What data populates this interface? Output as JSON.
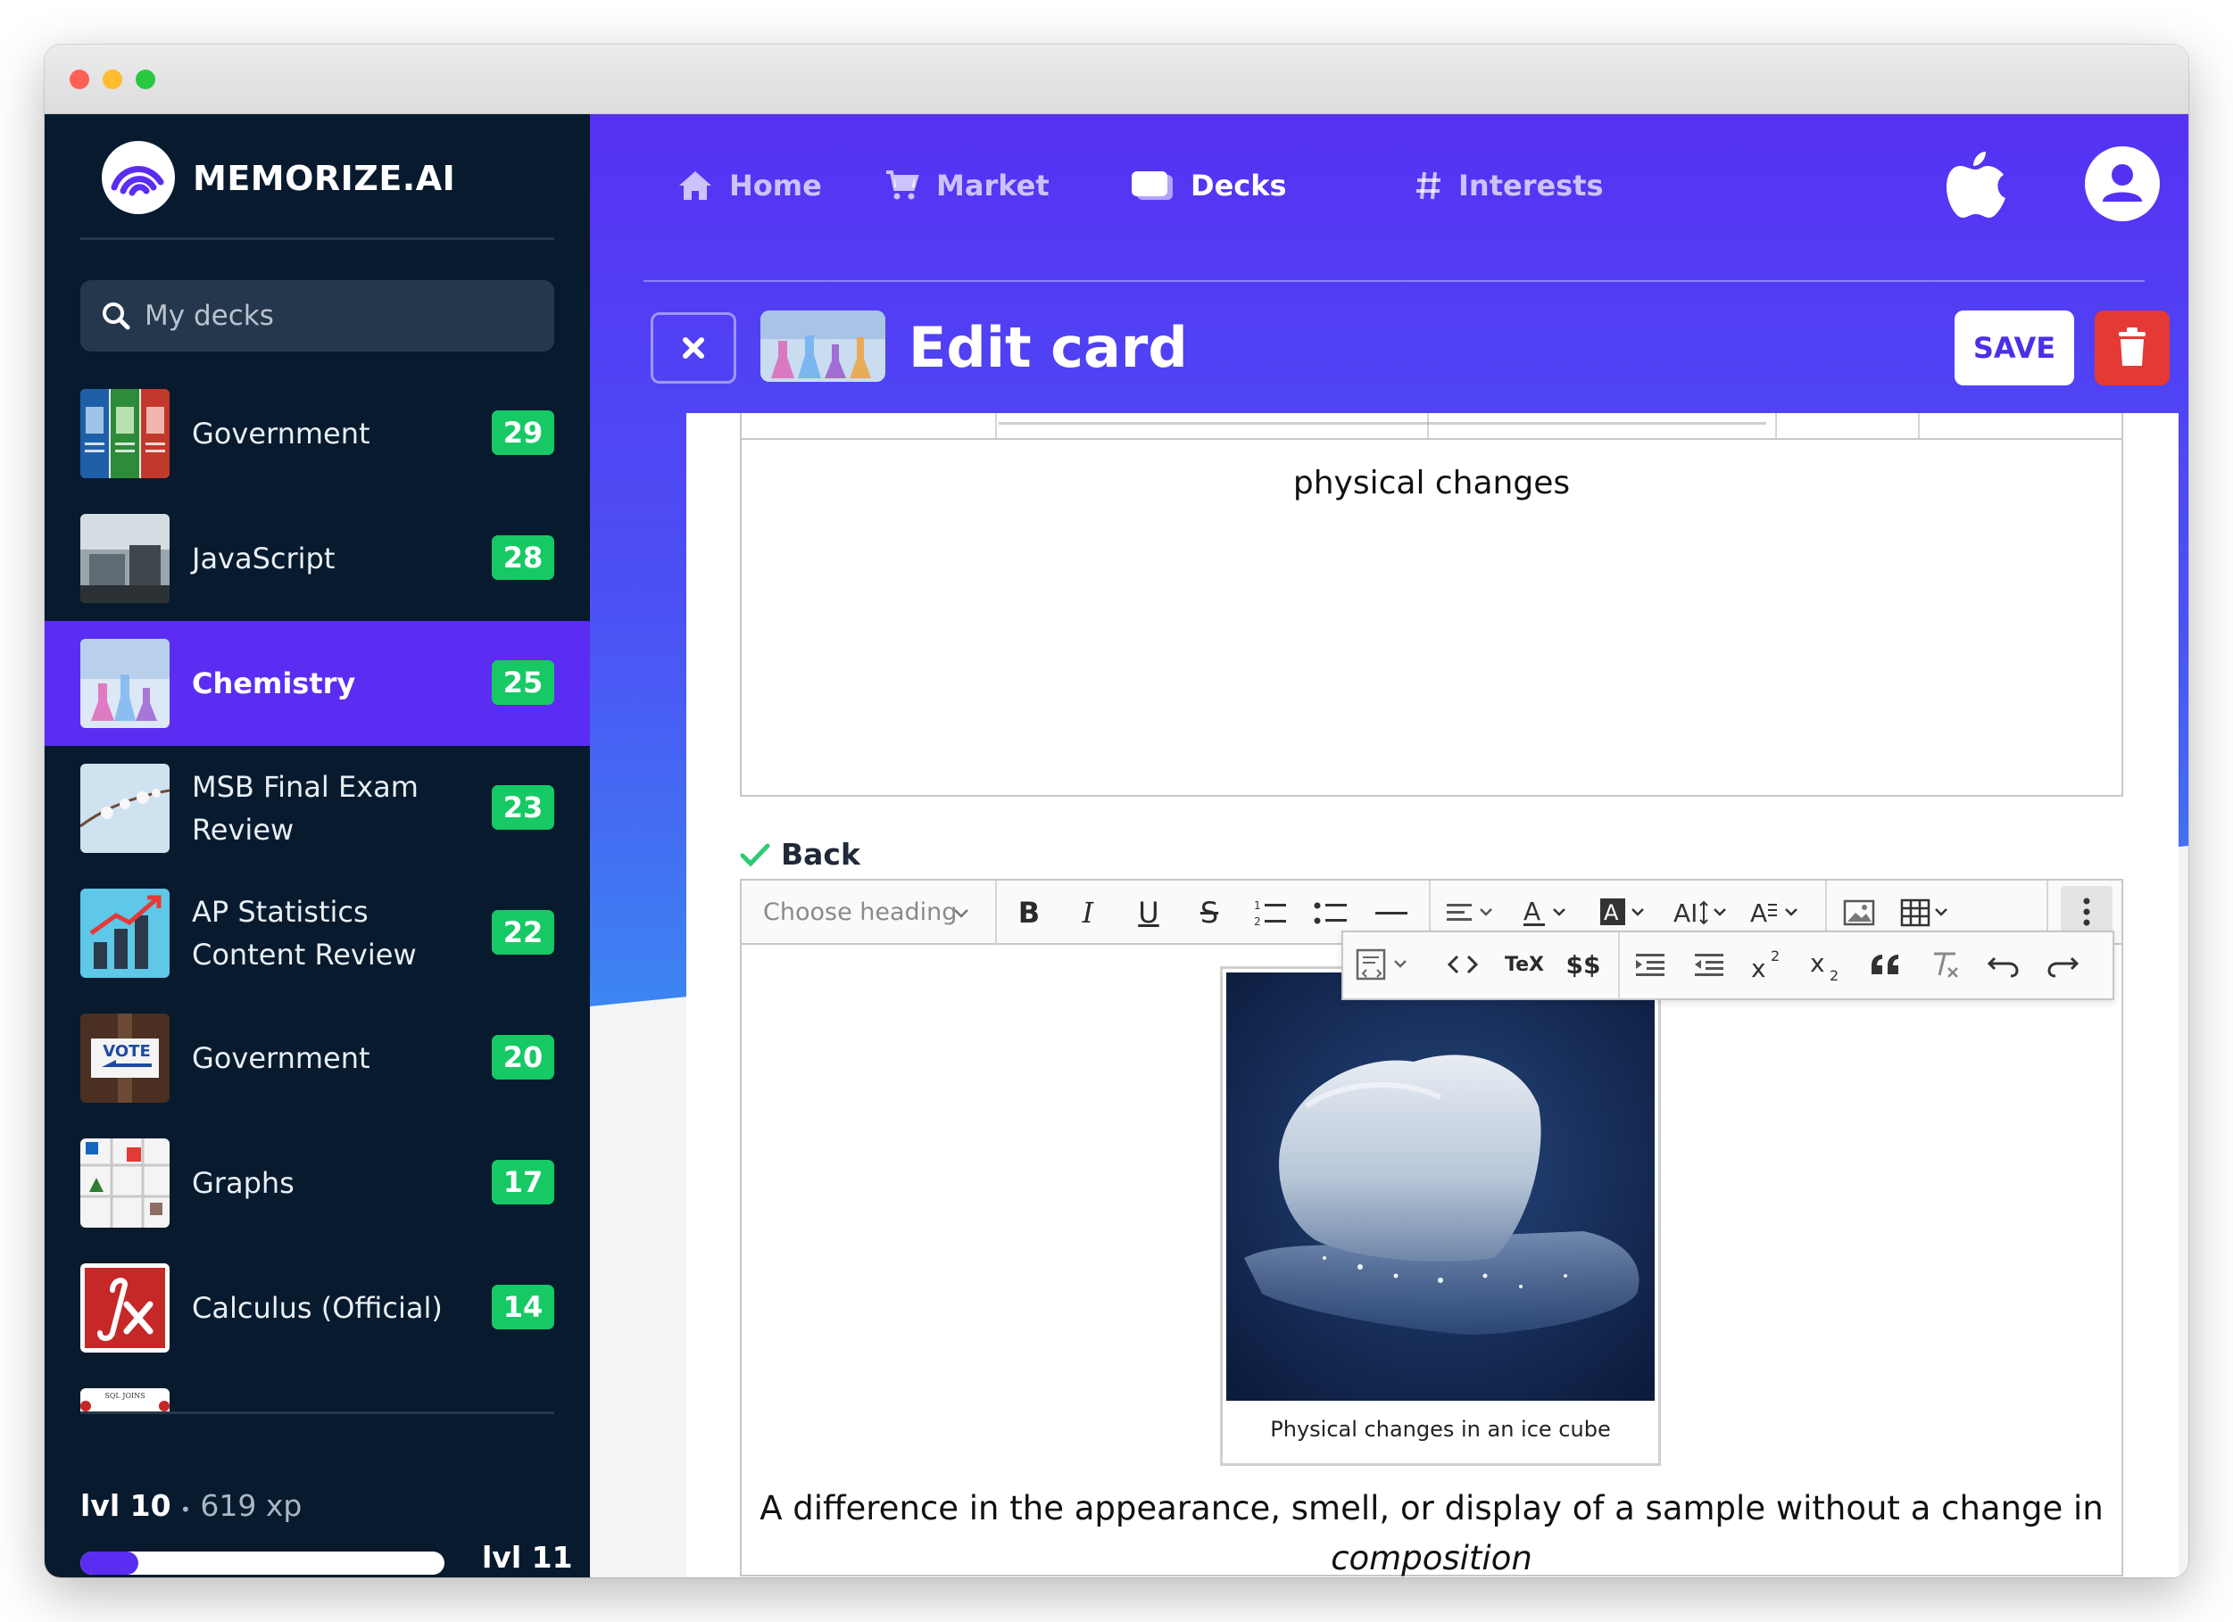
{
  "app": {
    "name": "MEMORIZE.AI",
    "colors": {
      "primary": "#5b2df2",
      "sidebar_bg": "#081a2e",
      "badge": "#17c964",
      "danger": "#e53935"
    }
  },
  "sidebar": {
    "search_placeholder": "My decks",
    "decks": [
      {
        "name": "Government",
        "count": "29",
        "active": false
      },
      {
        "name": "JavaScript",
        "count": "28",
        "active": false
      },
      {
        "name": "Chemistry",
        "count": "25",
        "active": true
      },
      {
        "name": "MSB Final Exam Review",
        "count": "23",
        "active": false
      },
      {
        "name": "AP Statistics Content Review",
        "count": "22",
        "active": false
      },
      {
        "name": "Government",
        "count": "20",
        "active": false
      },
      {
        "name": "Graphs",
        "count": "17",
        "active": false
      },
      {
        "name": "Calculus (Official)",
        "count": "14",
        "active": false
      }
    ],
    "thumb_texts": {
      "vote": "VOTE",
      "sql": "SQL JOINS"
    },
    "level": {
      "current": "lvl 10",
      "separator": "•",
      "xp": "619 xp",
      "next": "lvl 11",
      "progress": 0.16
    }
  },
  "nav": {
    "items": [
      {
        "label": "Home",
        "icon": "home-icon"
      },
      {
        "label": "Market",
        "icon": "cart-icon"
      },
      {
        "label": "Decks",
        "icon": "decks-icon",
        "active": true
      },
      {
        "label": "Interests",
        "icon": "hash-icon"
      }
    ]
  },
  "header": {
    "title": "Edit card",
    "save_label": "SAVE"
  },
  "card": {
    "front_text": "physical changes",
    "back_label": "Back",
    "toolbar": {
      "heading_placeholder": "Choose heading",
      "tex_label": "TeX",
      "math_label": "$$"
    },
    "figure_caption": "Physical changes in an ice cube",
    "back_text_1": "A difference in the appearance, smell, or display of a sample without a change in",
    "back_text_2": "composition"
  }
}
